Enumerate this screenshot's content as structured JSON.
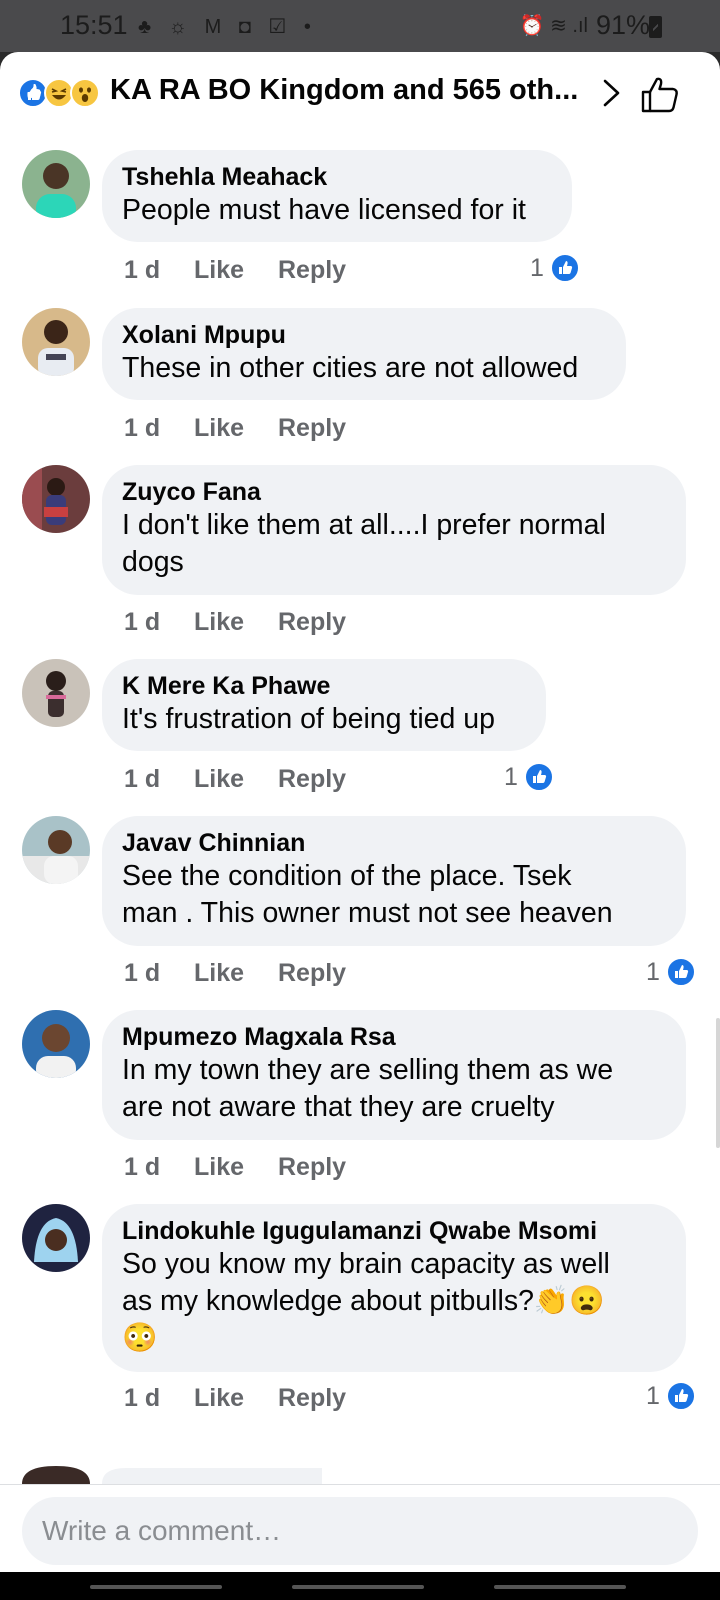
{
  "status_bar": {
    "time": "15:51",
    "left_icons": "♣ ☼ M ◘ ☑ •",
    "battery": "91%",
    "right_icons": "⏰ ≋ .ıl"
  },
  "header": {
    "title": "KA RA BO Kingdom and 565 oth...",
    "reactions": [
      "like",
      "haha",
      "wow"
    ]
  },
  "comments": [
    {
      "name": "Tshehla Meahack",
      "text": "People must have licensed for it",
      "time": "1 d",
      "like": "Like",
      "reply": "Reply",
      "likes": "1",
      "avatar_color": "#5a8f6a"
    },
    {
      "name": "Xolani Mpupu",
      "text": "These in other cities are not allowed",
      "time": "1 d",
      "like": "Like",
      "reply": "Reply",
      "likes": "",
      "avatar_color": "#b08a62"
    },
    {
      "name": "Zuyco Fana",
      "text": "I don't like them at all....I prefer normal\ndogs",
      "time": "1 d",
      "like": "Like",
      "reply": "Reply",
      "likes": "",
      "avatar_color": "#7a4a4a"
    },
    {
      "name": "K Mere Ka Phawe",
      "text": "It's frustration of being tied up",
      "time": "1 d",
      "like": "Like",
      "reply": "Reply",
      "likes": "1",
      "avatar_color": "#9b8f86"
    },
    {
      "name": "Javav Chinnian",
      "text": "See the condition of the place. Tsek\nman .  This owner must not see heaven",
      "time": "1 d",
      "like": "Like",
      "reply": "Reply",
      "likes": "1",
      "avatar_color": "#4b6a7a"
    },
    {
      "name": "Mpumezo Magxala Rsa",
      "text": "In my town they are selling them as we\nare not aware that they are cruelty",
      "time": "1 d",
      "like": "Like",
      "reply": "Reply",
      "likes": "",
      "avatar_color": "#3b6fa0"
    },
    {
      "name": "Lindokuhle Igugulamanzi Qwabe Msomi",
      "text": "So you know my brain capacity as well\nas my knowledge about pitbulls?👏😦\n😳",
      "time": "1 d",
      "like": "Like",
      "reply": "Reply",
      "likes": "1",
      "avatar_color": "#3a3f6a"
    }
  ],
  "composer": {
    "placeholder": "Write a comment…"
  },
  "colors": {
    "accent": "#1b74e4",
    "bubble": "#f0f2f5",
    "meta": "#65676b"
  }
}
